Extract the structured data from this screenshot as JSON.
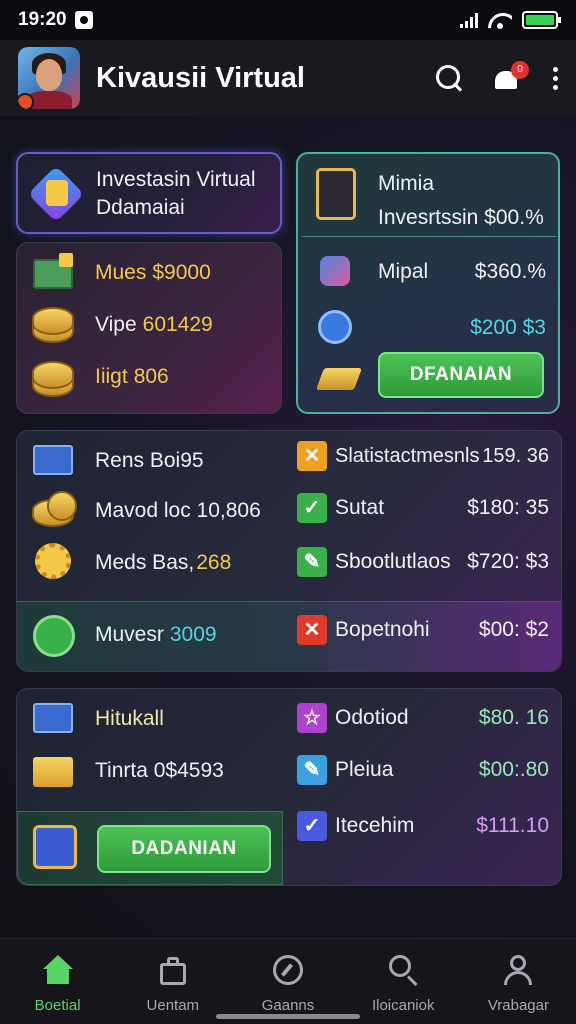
{
  "status_bar": {
    "time": "19:20"
  },
  "header": {
    "title": "Kivausii Virtual",
    "notification_count": "0"
  },
  "cards": {
    "top_left_title": {
      "line1": "Investasin Virtual",
      "line2": "Ddamaiai"
    },
    "assets": [
      {
        "label": "Mues",
        "value": "$9000"
      },
      {
        "label": "Vipe",
        "value": "601429"
      },
      {
        "label": "Iiigt",
        "value": "806"
      }
    ],
    "top_right": {
      "line1": "Mimia",
      "line2": "Invesrtssin $00.%",
      "rows": [
        {
          "label": "Mipal",
          "value": "$360.%"
        },
        {
          "label": "",
          "value": "$200 $3"
        }
      ],
      "button_label": "DFANAIAN"
    },
    "middle_left": [
      {
        "text": "Rens Boi95"
      },
      {
        "text": "Mavod loc 10,806"
      },
      {
        "text": "Meds Bas,",
        "highlight": "268"
      },
      {
        "text": "Muvesr",
        "highlight": "3009"
      }
    ],
    "middle_right": [
      {
        "label": "Slatistactmesnls",
        "value": "159. 36"
      },
      {
        "label": "Sutat",
        "value": "$180: 35"
      },
      {
        "label": "Sbootlutlaos",
        "value": "$720: $3"
      },
      {
        "label": "Bopetnohi",
        "value": "$00: $2"
      }
    ],
    "bottom_left": [
      {
        "text": "Hitukall"
      },
      {
        "text": "Tinrta 0$4593"
      }
    ],
    "bottom_left_button": "DADANIAN",
    "bottom_right": [
      {
        "label": "Odotiod",
        "value": "$80. 16"
      },
      {
        "label": "Pleiua",
        "value": "$00:.80"
      },
      {
        "label": "Itecehim",
        "value": "$111.10"
      }
    ]
  },
  "bottom_nav": [
    {
      "label": "Boetial",
      "active": true
    },
    {
      "label": "Uentam",
      "active": false
    },
    {
      "label": "Gaanns",
      "active": false
    },
    {
      "label": "Iloicaniok",
      "active": false
    },
    {
      "label": "Vrabagar",
      "active": false
    }
  ],
  "colors": {
    "accent_green": "#4cc356",
    "accent_yellow": "#f3c94a",
    "accent_cyan": "#4fd6e6"
  }
}
